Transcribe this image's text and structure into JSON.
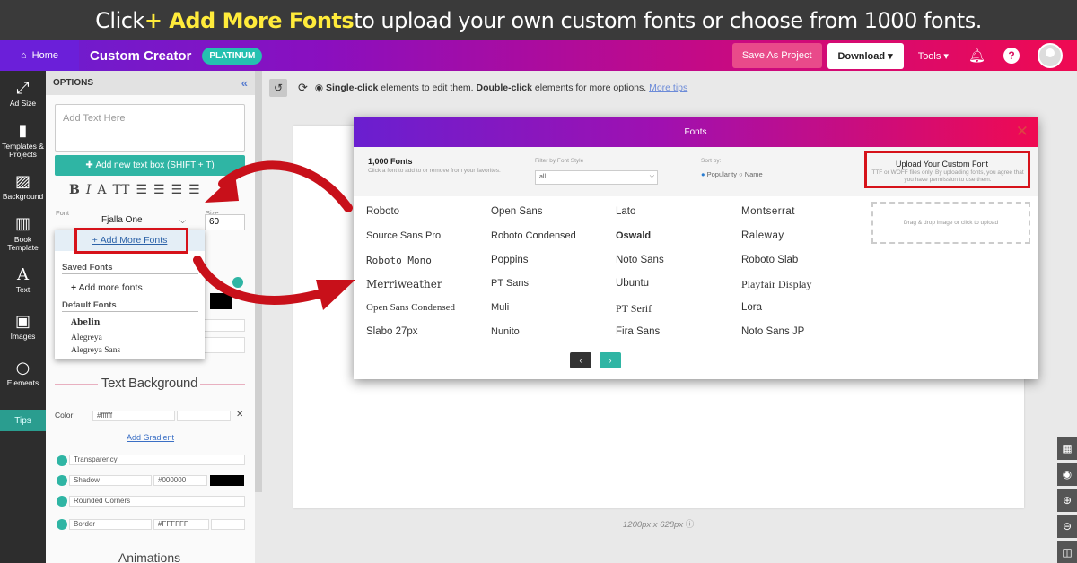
{
  "banner": {
    "pre": "Click ",
    "highlight": "+ Add More Fonts",
    "post": " to upload your own custom fonts or choose from 1000 fonts."
  },
  "topbar": {
    "home": "Home",
    "title": "Custom Creator",
    "badge": "PLATINUM",
    "save": "Save As Project",
    "download": "Download",
    "tools": "Tools"
  },
  "sidenav": [
    {
      "label": "Ad Size",
      "icon": "resize-icon"
    },
    {
      "label": "Templates & Projects",
      "icon": "bookmark-icon"
    },
    {
      "label": "Background",
      "icon": "image-icon"
    },
    {
      "label": "Book Template",
      "icon": "book-icon"
    },
    {
      "label": "Text",
      "icon": "text-icon"
    },
    {
      "label": "Images",
      "icon": "image-icon"
    },
    {
      "label": "Elements",
      "icon": "circle-icon"
    }
  ],
  "tips": "Tips",
  "options": {
    "title": "OPTIONS",
    "text_placeholder": "Add Text Here",
    "add_textbox": "Add new text box (SHIFT + T)",
    "font_label": "Font",
    "font_value": "Fjalla One",
    "size_label": "Size",
    "size_value": "60",
    "bg_title": "Text Background",
    "color_label": "Color",
    "color_value": "#ffffff",
    "add_gradient": "Add Gradient",
    "transparency": "Transparency",
    "shadow": "Shadow",
    "shadow_value": "#000000",
    "rounded": "Rounded Corners",
    "border": "Border",
    "border_value": "#FFFFFF",
    "spacing": "cing",
    "animations": "Animations"
  },
  "dropdown": {
    "add_more": "Add More Fonts",
    "saved_head": "Saved Fonts",
    "add_more_plain": "Add more fonts",
    "default_head": "Default Fonts",
    "items": [
      "Abelin",
      "Alegreya",
      "Alegreya Sans"
    ]
  },
  "toolstrip": {
    "bold1": "Single-click",
    "t1": " elements to edit them. ",
    "bold2": "Double-click",
    "t2": " elements for more options. ",
    "link": "More tips"
  },
  "canvas_dims": "1200px x 628px",
  "modal": {
    "title": "Fonts",
    "count": "1,000 Fonts",
    "count_sub": "Click a font to add to or remove from your favorites.",
    "filter_label": "Filter by Font Style",
    "filter_value": "all",
    "sort_label": "Sort by:",
    "sort_pop": "Popularity",
    "sort_name": "Name",
    "upload_title": "Upload Your Custom Font",
    "upload_sub": "TTF or WOFF files only. By uploading fonts, you agree that you have permission to use them.",
    "drop": "Drag & drop image or click to upload",
    "fonts": [
      [
        "Roboto",
        "Open Sans",
        "Lato",
        "Montserrat"
      ],
      [
        "Source Sans Pro",
        "Roboto Condensed",
        "Oswald",
        "Raleway"
      ],
      [
        "Roboto Mono",
        "Poppins",
        "Noto Sans",
        "Roboto Slab"
      ],
      [
        "Merriweather",
        "PT Sans",
        "Ubuntu",
        "Playfair Display"
      ],
      [
        "Open Sans Condensed",
        "Muli",
        "PT Serif",
        "Lora"
      ],
      [
        "Slabo 27px",
        "Nunito",
        "Fira Sans",
        "Noto Sans JP"
      ]
    ]
  },
  "colors": {
    "accent": "#2fb5a4",
    "red": "#d6121a",
    "purple": "#6a1fd0",
    "pink": "#ef0a52"
  }
}
